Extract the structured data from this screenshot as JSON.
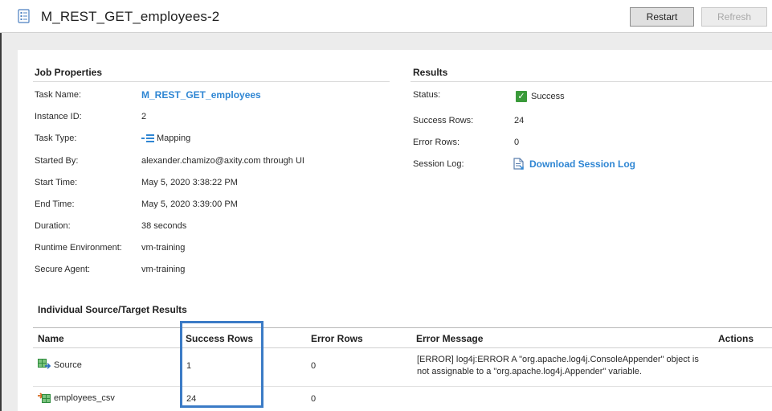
{
  "header": {
    "title": "M_REST_GET_employees-2",
    "restart_label": "Restart",
    "refresh_label": "Refresh"
  },
  "job_properties": {
    "title": "Job Properties",
    "task_name_label": "Task Name:",
    "task_name_value": "M_REST_GET_employees",
    "instance_id_label": "Instance ID:",
    "instance_id_value": "2",
    "task_type_label": "Task Type:",
    "task_type_value": "Mapping",
    "started_by_label": "Started By:",
    "started_by_value": "alexander.chamizo@axity.com through UI",
    "start_time_label": "Start Time:",
    "start_time_value": "May 5, 2020 3:38:22 PM",
    "end_time_label": "End Time:",
    "end_time_value": "May 5, 2020 3:39:00 PM",
    "duration_label": "Duration:",
    "duration_value": "38 seconds",
    "runtime_env_label": "Runtime Environment:",
    "runtime_env_value": "vm-training",
    "secure_agent_label": "Secure Agent:",
    "secure_agent_value": "vm-training"
  },
  "results": {
    "title": "Results",
    "status_label": "Status:",
    "status_value": "Success",
    "success_rows_label": "Success Rows:",
    "success_rows_value": "24",
    "error_rows_label": "Error Rows:",
    "error_rows_value": "0",
    "session_log_label": "Session Log:",
    "session_log_link": "Download Session Log"
  },
  "individual": {
    "title": "Individual Source/Target Results",
    "columns": [
      "Name",
      "Success Rows",
      "Error Rows",
      "Error Message",
      "Actions"
    ],
    "rows": [
      {
        "name": "Source",
        "success_rows": "1",
        "error_rows": "0",
        "error_message_line1": "[ERROR] log4j:ERROR A \"org.apache.log4j.ConsoleAppender\" object is",
        "error_message_line2": "not assignable to a \"org.apache.log4j.Appender\" variable."
      },
      {
        "name": "employees_csv",
        "success_rows": "24",
        "error_rows": "0",
        "error_message_line1": "",
        "error_message_line2": ""
      }
    ]
  },
  "colors": {
    "accent_link": "#2f86d3",
    "success_green": "#3a9a3a",
    "highlight_border": "#3b7bc6"
  }
}
